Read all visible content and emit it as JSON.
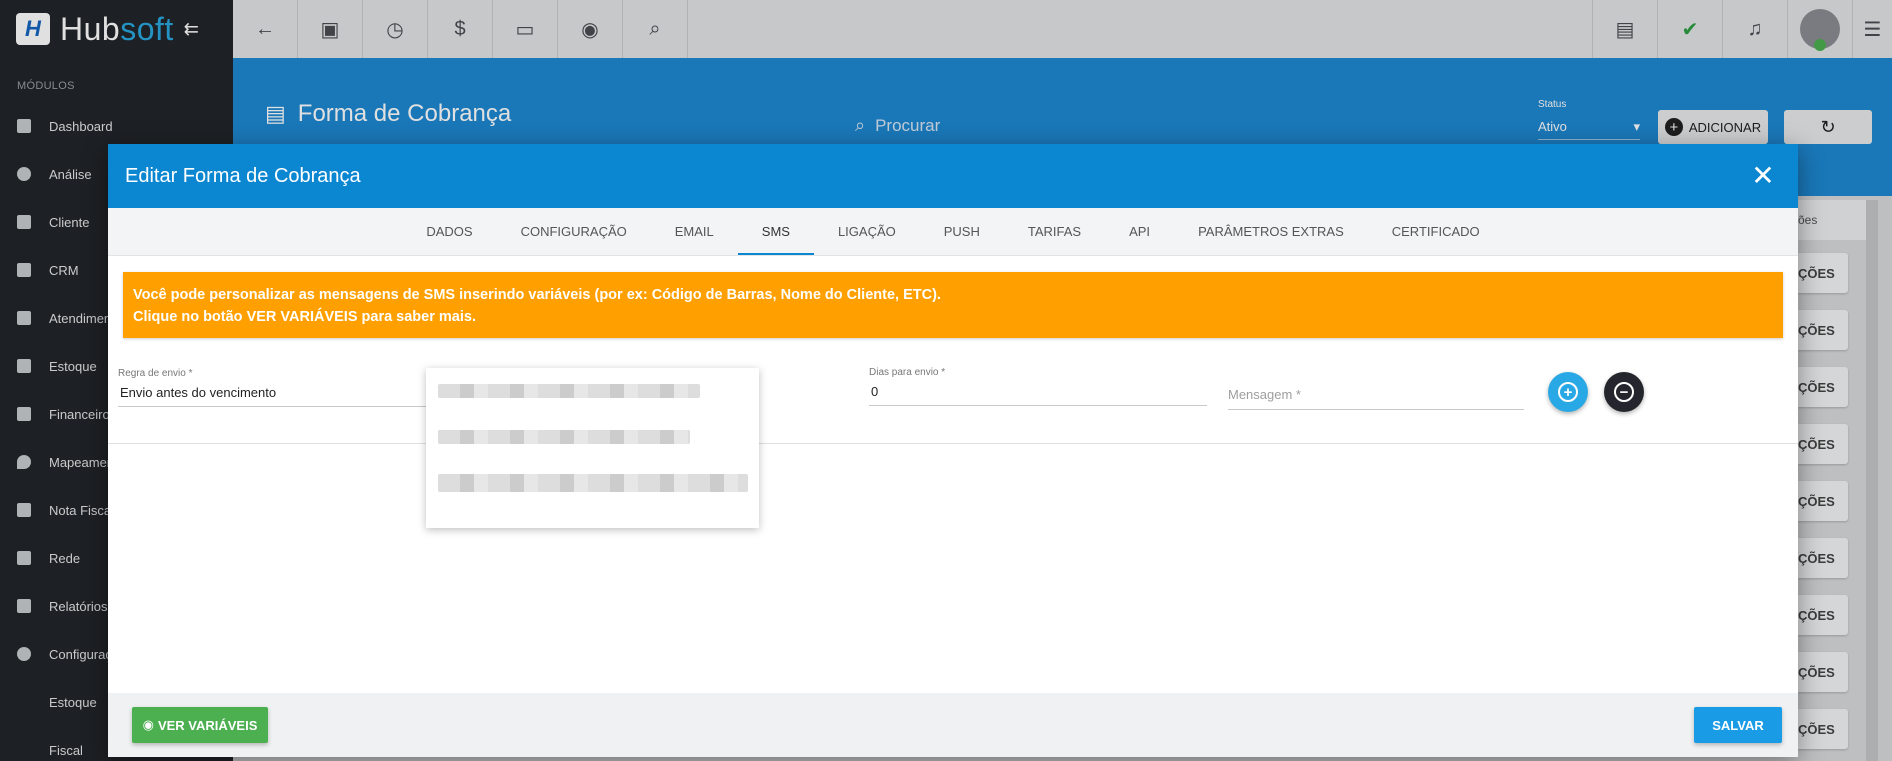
{
  "app": {
    "logo_main": "Hub",
    "logo_accent": "soft",
    "logo_initial": "H"
  },
  "sidebar": {
    "section": "MÓDULOS",
    "items": [
      {
        "label": "Dashboard",
        "icon": "dashboard-icon"
      },
      {
        "label": "Análise",
        "icon": "pie-chart-icon"
      },
      {
        "label": "Cliente",
        "icon": "contact-card-icon"
      },
      {
        "label": "CRM",
        "icon": "crm-board-icon"
      },
      {
        "label": "Atendimento",
        "icon": "calendar-clock-icon"
      },
      {
        "label": "Estoque",
        "icon": "box-icon"
      },
      {
        "label": "Financeiro",
        "icon": "money-icon"
      },
      {
        "label": "Mapeamento",
        "icon": "map-pin-icon"
      },
      {
        "label": "Nota Fiscal",
        "icon": "document-icon"
      },
      {
        "label": "Rede",
        "icon": "server-icon"
      },
      {
        "label": "Relatórios",
        "icon": "report-icon"
      },
      {
        "label": "Configurações",
        "icon": "gear-icon"
      }
    ],
    "subitems": [
      {
        "label": "Estoque"
      },
      {
        "label": "Fiscal"
      }
    ]
  },
  "topbar": {
    "icons": [
      "back-arrow-icon",
      "contact-card-icon",
      "calendar-clock-icon",
      "dollar-icon",
      "terminal-icon",
      "eye-icon",
      "search-icon"
    ],
    "right_icons": [
      "pdf-icon",
      "chat-check-icon",
      "bell-icon",
      "avatar",
      "list-icon"
    ]
  },
  "page": {
    "title": "Forma de Cobrança",
    "search_placeholder": "Procurar",
    "status_label": "Status",
    "status_value": "Ativo",
    "add_label": "ADICIONAR",
    "table_head_fragment": "ões",
    "action_fragment": "ÇÕES"
  },
  "modal": {
    "title": "Editar Forma de Cobrança",
    "tabs": [
      "DADOS",
      "CONFIGURAÇÃO",
      "EMAIL",
      "SMS",
      "LIGAÇÃO",
      "PUSH",
      "TARIFAS",
      "API",
      "PARÂMETROS EXTRAS",
      "CERTIFICADO"
    ],
    "active_tab": "SMS",
    "alert_line1": "Você pode personalizar as mensagens de SMS inserindo variáveis (por ex: Código de Barras, Nome do Cliente, ETC).",
    "alert_line2": "Clique no botão VER VARIÁVEIS para saber mais.",
    "form": {
      "rule_label": "Regra de envio *",
      "rule_value": "Envio antes do vencimento",
      "days_label": "Dias para envio *",
      "days_value": "0",
      "message_placeholder": "Mensagem *"
    },
    "footer": {
      "vars_label": "VER VARIÁVEIS",
      "save_label": "SALVAR"
    }
  },
  "colors": {
    "primary": "#0b86d1",
    "alert": "#ffa000",
    "success": "#4caf50",
    "sidebar": "#22252a"
  }
}
